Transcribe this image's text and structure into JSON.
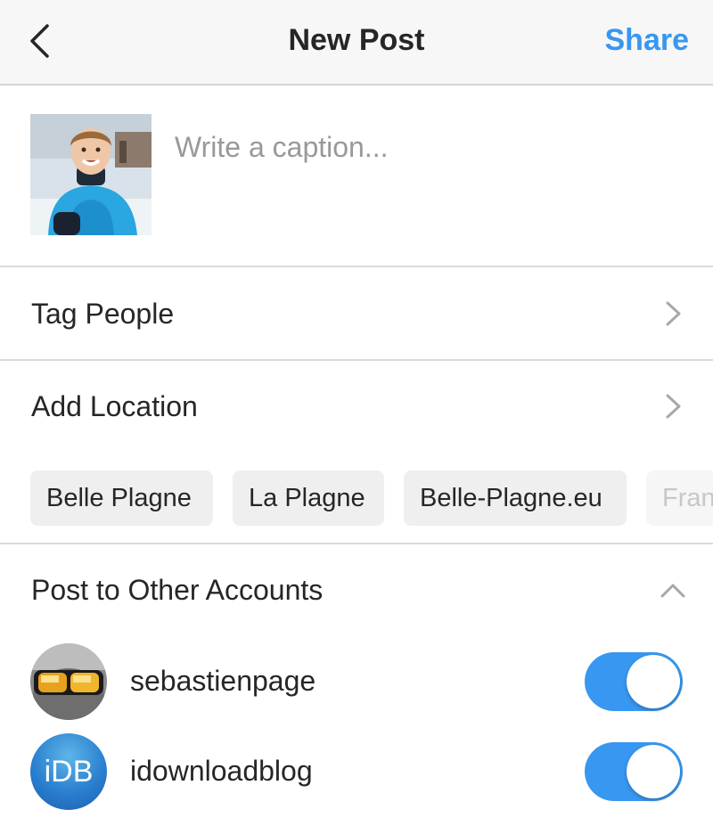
{
  "header": {
    "title": "New Post",
    "share_label": "Share",
    "back_icon": "chevron-left-icon"
  },
  "caption": {
    "placeholder": "Write a caption...",
    "value": ""
  },
  "rows": {
    "tag_people": "Tag People",
    "add_location": "Add Location"
  },
  "location_suggestions": [
    "Belle Plagne",
    "La Plagne",
    "Belle-Plagne.eu",
    "Fran"
  ],
  "other_accounts": {
    "title": "Post to Other Accounts",
    "accounts": [
      {
        "name": "sebastienpage",
        "enabled": true
      },
      {
        "name": "idownloadblog",
        "avatar_text": "iDB",
        "enabled": true
      }
    ]
  },
  "colors": {
    "accent": "#3897f0",
    "divider": "#dbdbdb",
    "header_bg": "#f7f7f7",
    "chip_bg": "#efefef"
  }
}
